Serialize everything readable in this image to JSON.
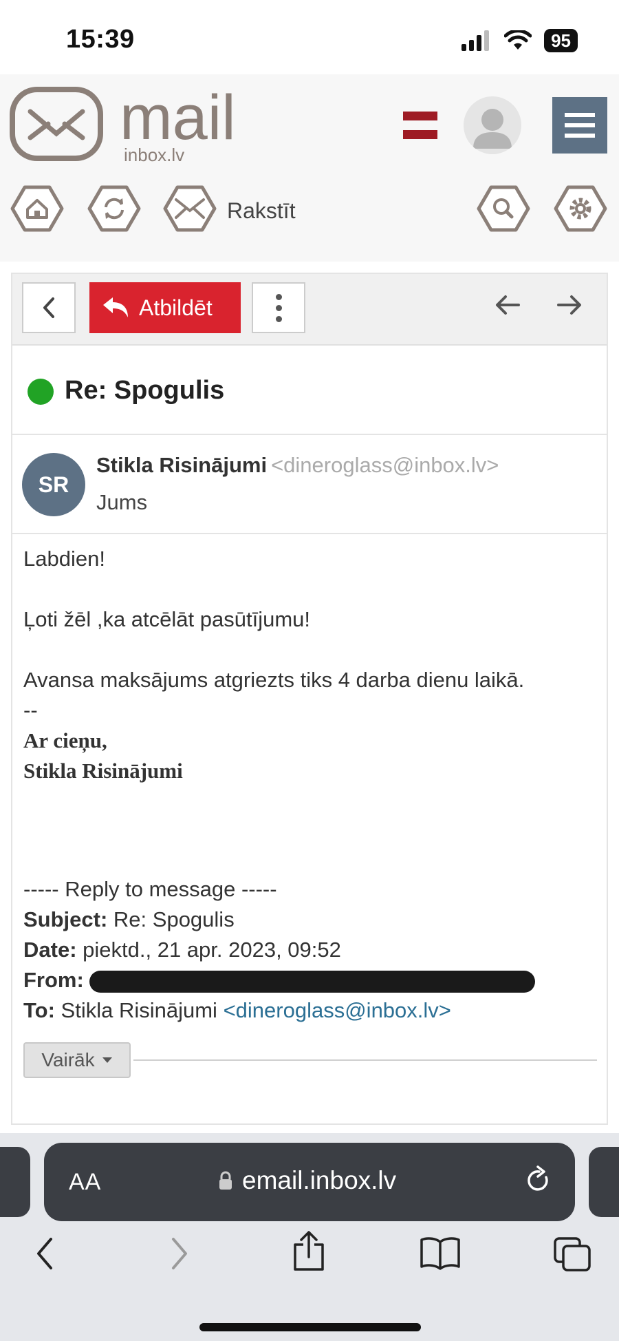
{
  "status_bar": {
    "time": "15:39",
    "battery": "95"
  },
  "header": {
    "logo_text": "mail",
    "logo_sub": "inbox.lv",
    "compose_label": "Rakstīt",
    "flag_colors": [
      "#9e1b24",
      "#ffffff",
      "#9e1b24"
    ]
  },
  "toolbar": {
    "reply_label": "Atbildēt"
  },
  "message": {
    "subject": "Re: Spogulis",
    "sender_initials": "SR",
    "sender_name": "Stikla Risinājumi",
    "sender_email": "<dineroglass@inbox.lv>",
    "recipient": "Jums",
    "body": {
      "greeting": "Labdien!",
      "line1": "Ļoti žēl ,ka atcēlāt pasūtījumu!",
      "line2": "Avansa maksājums atgriezts tiks 4 darba dienu laikā.",
      "separator": "--",
      "sign1": "Ar cieņu,",
      "sign2": "Stikla Risinājumi"
    },
    "reply": {
      "heading": "----- Reply to message -----",
      "subject_label": "Subject:",
      "subject_value": "Re: Spogulis",
      "date_label": "Date:",
      "date_value": "piektd., 21 apr. 2023, 09:52",
      "from_label": "From:",
      "to_label": "To:",
      "to_name": "Stikla Risinājumi",
      "to_email": "<dineroglass@inbox.lv>"
    },
    "more_label": "Vairāk"
  },
  "browser": {
    "aa_label": "AA",
    "url": "email.inbox.lv"
  },
  "colors": {
    "reply_button": "#d9232e",
    "avatar": "#5d7185",
    "status_dot": "#21a325",
    "link": "#2b6f94"
  }
}
